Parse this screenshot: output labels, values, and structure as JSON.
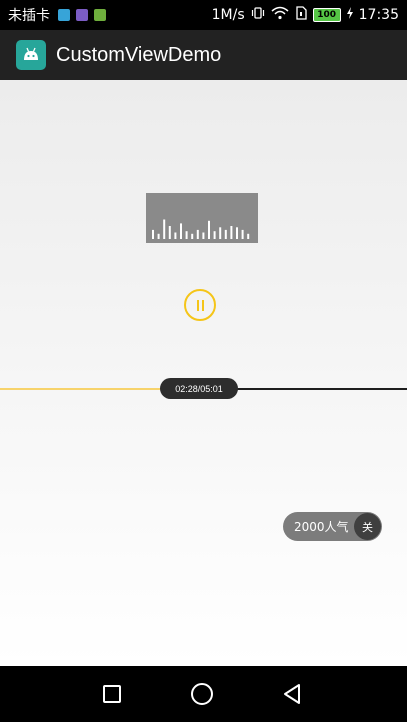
{
  "status_bar": {
    "carrier": "未插卡",
    "net_speed": "1M/s",
    "battery": "100",
    "time": "17:35",
    "notif_colors": [
      "#37a4d8",
      "#7b5cc4",
      "#6fae3d"
    ]
  },
  "app_bar": {
    "title": "CustomViewDemo",
    "icon": "android-icon"
  },
  "player": {
    "waveform_levels": [
      0.35,
      0.2,
      0.75,
      0.5,
      0.25,
      0.6,
      0.3,
      0.2,
      0.35,
      0.25,
      0.7,
      0.3,
      0.45,
      0.35,
      0.5,
      0.45,
      0.35,
      0.2
    ],
    "progress_fraction": 0.43,
    "time_label": "02:28/05:01",
    "accent_color": "#f5c518"
  },
  "popularity": {
    "label": "2000人气",
    "close_label": "关"
  },
  "nav_bar": {
    "recents_icon": "square-icon",
    "home_icon": "circle-icon",
    "back_icon": "triangle-back-icon"
  }
}
